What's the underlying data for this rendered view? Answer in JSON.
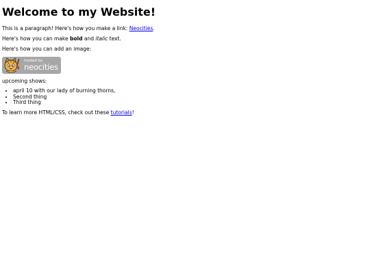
{
  "heading": "Welcome to my Website!",
  "intro": {
    "text": "This is a paragraph! Here's how you make a link: ",
    "link_label": "Neocities",
    "after": "."
  },
  "format": {
    "before": "Here's how you can make ",
    "bold": "bold",
    "middle": " and ",
    "italic": "italic",
    "after": " text."
  },
  "image_line": "Here's how you can add an image:",
  "badge": {
    "small_text": "hosted by",
    "big_text": "neocities",
    "icon": "neocities-cat-icon",
    "background": "#a7a7a7"
  },
  "list_title": "upcoming shows:",
  "list_items": [
    "april 10 with our lady of burning thorns,",
    "Second thing",
    "Third thing"
  ],
  "footer": {
    "before": "To learn more HTML/CSS, check out these ",
    "link_label": "tutorials",
    "after": "!"
  },
  "colors": {
    "link": "#0000ee",
    "text": "#000000"
  }
}
